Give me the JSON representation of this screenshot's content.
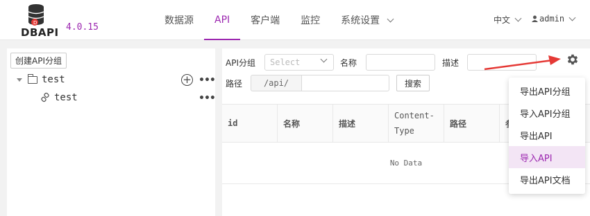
{
  "header": {
    "logo_text": "DBAPI",
    "version": "4.0.15",
    "nav": [
      {
        "label": "数据源"
      },
      {
        "label": "API"
      },
      {
        "label": "客户端"
      },
      {
        "label": "监控"
      },
      {
        "label": "系统设置"
      }
    ],
    "active_nav": "API",
    "language": "中文",
    "user": "admin"
  },
  "left": {
    "create_button": "创建API分组",
    "tree": [
      {
        "label": "test",
        "type": "group",
        "icon": "folder-icon"
      },
      {
        "label": "test",
        "type": "api",
        "icon": "link-icon"
      }
    ],
    "more_glyph": "•••",
    "plus_glyph": "+"
  },
  "filters": {
    "group_label": "API分组",
    "group_placeholder": "Select",
    "name_label": "名称",
    "desc_label": "描述",
    "path_label": "路径",
    "path_prefix": "/api/",
    "search_button": "搜索"
  },
  "table": {
    "columns": [
      "id",
      "名称",
      "描述",
      "Content-Type",
      "路径",
      "参"
    ],
    "empty_text": "No Data"
  },
  "dropdown": {
    "items": [
      {
        "label": "导出API分组"
      },
      {
        "label": "导入API分组"
      },
      {
        "label": "导出API"
      },
      {
        "label": "导入API"
      },
      {
        "label": "导出API文档"
      }
    ],
    "highlighted": "导入API"
  },
  "colors": {
    "accent": "#9c27b0",
    "arrow": "#e53935",
    "highlight_bg": "#f3e5f5"
  }
}
